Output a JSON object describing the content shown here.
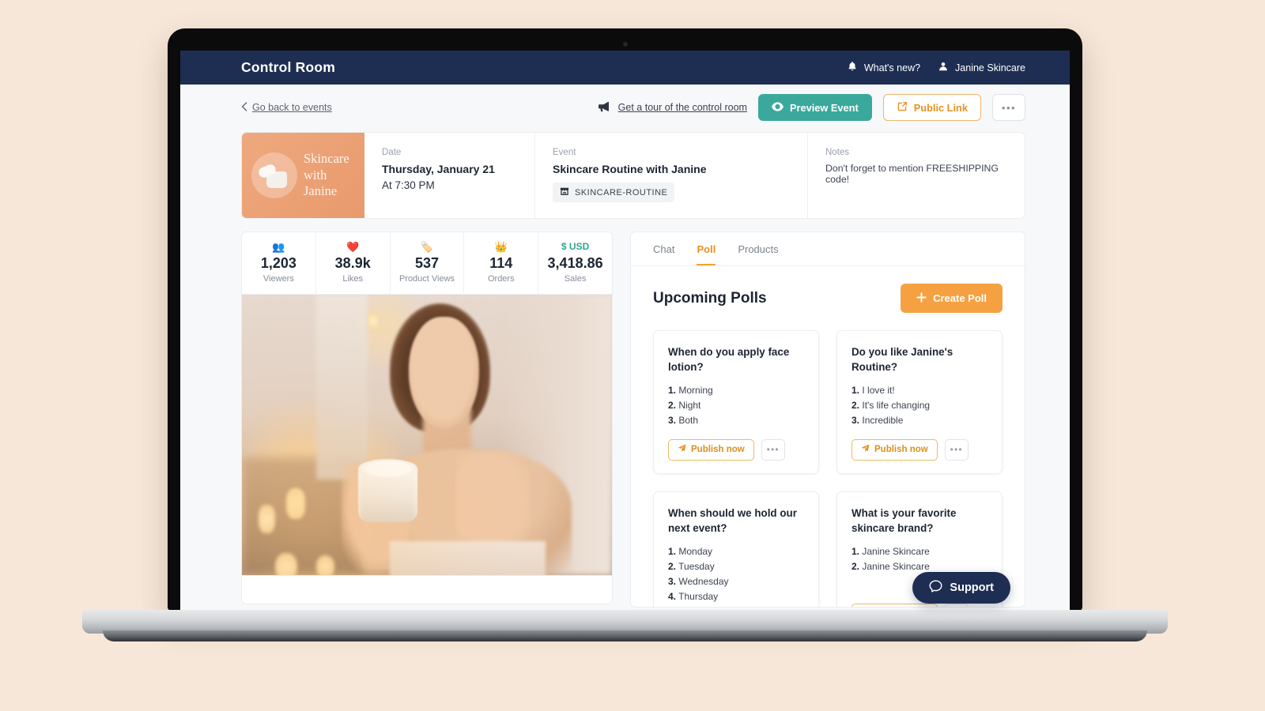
{
  "app": {
    "title": "Control Room",
    "topbar": {
      "whats_new": "What's new?",
      "whats_new_icon": "bell-icon",
      "account": "Janine Skincare",
      "account_icon": "user-icon"
    }
  },
  "toolbar": {
    "back_label": "Go back to events",
    "back_icon": "chevron-left-icon",
    "tour_label": "Get a tour of the control room",
    "tour_icon": "megaphone-icon",
    "preview_label": "Preview Event",
    "preview_icon": "eye-icon",
    "public_link_label": "Public Link",
    "public_link_icon": "external-link-icon",
    "more_label": "•••",
    "more_icon": "ellipsis-icon"
  },
  "event_card": {
    "thumb_title": "Skincare\nwith\nJanine",
    "thumb_icon": "cream-jar-icon",
    "date_label": "Date",
    "date_value": "Thursday, January 21",
    "time_value": "At 7:30 PM",
    "event_label": "Event",
    "event_value": "Skincare Routine with Janine",
    "tag_icon": "store-icon",
    "tag_value": "SKINCARE-ROUTINE",
    "notes_label": "Notes",
    "notes_value": "Don't forget to mention FREESHIPPING code!"
  },
  "stats": [
    {
      "icon": "people-icon",
      "glyph": "👥",
      "value": "1,203",
      "label": "Viewers"
    },
    {
      "icon": "heart-icon",
      "glyph": "❤️",
      "value": "38.9k",
      "label": "Likes"
    },
    {
      "icon": "tag-icon",
      "glyph": "🏷️",
      "value": "537",
      "label": "Product Views"
    },
    {
      "icon": "orders-icon",
      "glyph": "👑",
      "value": "114",
      "label": "Orders"
    },
    {
      "icon": "currency-label",
      "glyph": "$ USD",
      "value": "3,418.86",
      "label": "Sales"
    }
  ],
  "tabs": [
    {
      "label": "Chat",
      "active": false
    },
    {
      "label": "Poll",
      "active": true
    },
    {
      "label": "Products",
      "active": false
    }
  ],
  "polls": {
    "heading": "Upcoming Polls",
    "create_label": "Create Poll",
    "create_icon": "plus-icon",
    "publish_label": "Publish now",
    "publish_icon": "paper-plane-icon",
    "more_label": "•••",
    "items": [
      {
        "question": "When do you apply face lotion?",
        "options": [
          "Morning",
          "Night",
          "Both"
        ]
      },
      {
        "question": "Do you like Janine's Routine?",
        "options": [
          "I love it!",
          "It's life changing",
          "Incredible"
        ]
      },
      {
        "question": "When should we hold our next event?",
        "options": [
          "Monday",
          "Tuesday",
          "Wednesday",
          "Thursday"
        ]
      },
      {
        "question": "What is your favorite skincare brand?",
        "options": [
          "Janine Skincare",
          "Janine Skincare"
        ]
      }
    ]
  },
  "support": {
    "label": "Support",
    "icon": "chat-bubble-icon"
  },
  "device": {
    "label": "MacBook Pro"
  },
  "colors": {
    "background": "#f7e7d8",
    "navy": "#1e2e52",
    "teal": "#3aa99b",
    "orange": "#f5a142",
    "orange_text": "#e8921f",
    "peach": "#efa87e"
  }
}
